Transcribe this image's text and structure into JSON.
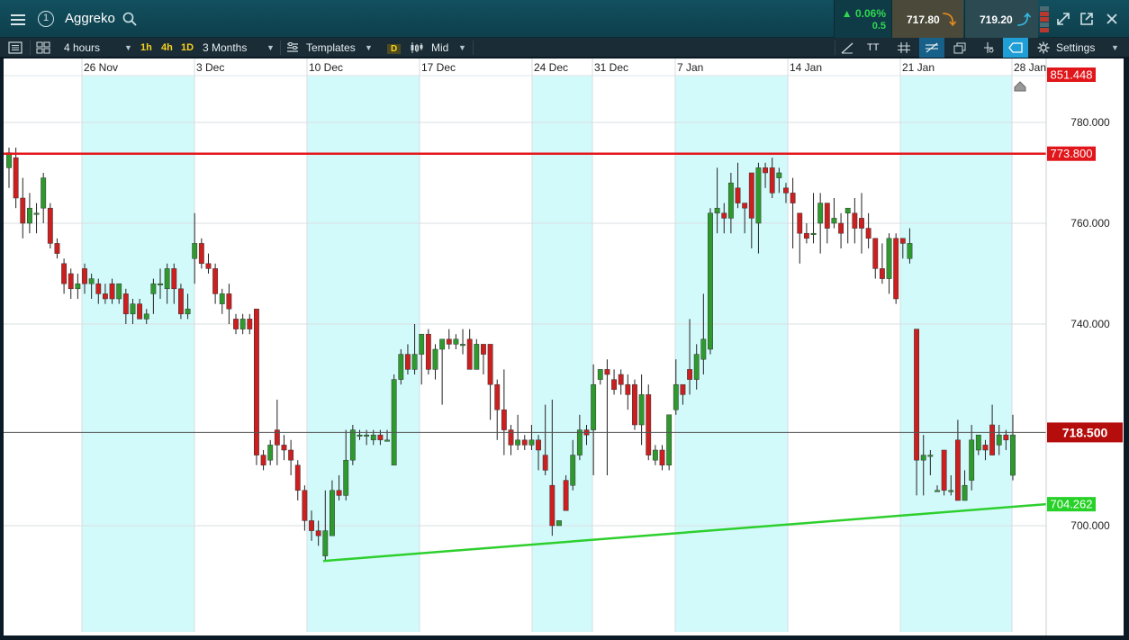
{
  "header": {
    "badge": "1",
    "title": "Aggreko",
    "change_pct": "▲ 0.06%",
    "change_abs": "0.5",
    "bid": "717.80",
    "ask": "719.20"
  },
  "toolbar": {
    "interval": "4 hours",
    "quick_1h": "1h",
    "quick_4h": "4h",
    "quick_1d": "1D",
    "range": "3 Months",
    "templates": "Templates",
    "d_label": "D",
    "price_type": "Mid",
    "text_tool": "TT",
    "settings": "Settings"
  },
  "chart_data": {
    "type": "candlestick",
    "instrument": "Aggreko",
    "timeframe": "4 hours",
    "ylim": [
      686,
      797
    ],
    "yticks": [
      {
        "value": 780,
        "label": "780.000"
      },
      {
        "value": 760,
        "label": "760.000"
      },
      {
        "value": 740,
        "label": "740.000"
      },
      {
        "value": 700,
        "label": "700.000"
      }
    ],
    "xticks": [
      "26 Nov",
      "3 Dec",
      "10 Dec",
      "17 Dec",
      "24 Dec",
      "31 Dec",
      "7 Jan",
      "14 Jan",
      "21 Jan",
      "28 Jan"
    ],
    "price_labels": {
      "top": "851.448",
      "resistance": "773.800",
      "last": "718.500",
      "support": "704.262"
    },
    "resistance_level": 773.8,
    "current_price": 718.5,
    "support_trendline": {
      "start_value": 693,
      "end_value": 704.262
    },
    "colors": {
      "up": "#2e9a2e",
      "down": "#cc1f1f",
      "resistance": "#e3171c",
      "support": "#2dcf2d",
      "highlight": "#d3fafb",
      "last_price": "#b50c0c"
    },
    "candles": [
      [
        771,
        774,
        767,
        775
      ],
      [
        773,
        765,
        763,
        775
      ],
      [
        765,
        760,
        757,
        769
      ],
      [
        760,
        763,
        758,
        766
      ],
      [
        762,
        762,
        758,
        764
      ],
      [
        763,
        769,
        760,
        770
      ],
      [
        763,
        756,
        755,
        764
      ],
      [
        756,
        754,
        753,
        757
      ],
      [
        752,
        748,
        746,
        753
      ],
      [
        750,
        747,
        745,
        751
      ],
      [
        747,
        748,
        745,
        750
      ],
      [
        751,
        748,
        746,
        752
      ],
      [
        748,
        749,
        745,
        750
      ],
      [
        748,
        746,
        744,
        749
      ],
      [
        746,
        745,
        744,
        748
      ],
      [
        748,
        745,
        744,
        749
      ],
      [
        745,
        748,
        744,
        748
      ],
      [
        746,
        742,
        740,
        747
      ],
      [
        742,
        744,
        740,
        745
      ],
      [
        744,
        741,
        741,
        745
      ],
      [
        741,
        742,
        740,
        743
      ],
      [
        746,
        748,
        742,
        749
      ],
      [
        748,
        748,
        745,
        751
      ],
      [
        747,
        751,
        744,
        752
      ],
      [
        751,
        747,
        744,
        752
      ],
      [
        747,
        742,
        741,
        748
      ],
      [
        742,
        743,
        741,
        746
      ],
      [
        753,
        756,
        748,
        762
      ],
      [
        756,
        752,
        751,
        757
      ],
      [
        752,
        751,
        750,
        754
      ],
      [
        751,
        746,
        744,
        752
      ],
      [
        744,
        746,
        742,
        747
      ],
      [
        746,
        743,
        740,
        748
      ],
      [
        741,
        739,
        738,
        742
      ],
      [
        739,
        741,
        738,
        742
      ],
      [
        741,
        739,
        738,
        742
      ],
      [
        743,
        714,
        712,
        743
      ],
      [
        714,
        712,
        711,
        715
      ],
      [
        713,
        716,
        712,
        717
      ],
      [
        719,
        716,
        712,
        725
      ],
      [
        716,
        715,
        713,
        718
      ],
      [
        715,
        713,
        710,
        717
      ],
      [
        712,
        707,
        705,
        713
      ],
      [
        707,
        701,
        699,
        708
      ],
      [
        701,
        699,
        697,
        703
      ],
      [
        699,
        698,
        696,
        701
      ],
      [
        694,
        699,
        693,
        707
      ],
      [
        698,
        707,
        705,
        709
      ],
      [
        707,
        706,
        705,
        710
      ],
      [
        706,
        713,
        705,
        719
      ],
      [
        713,
        719,
        712,
        720
      ],
      [
        718,
        718,
        717,
        719
      ],
      [
        718,
        718,
        716,
        719
      ],
      [
        717,
        718,
        716,
        719
      ],
      [
        718,
        717,
        716,
        719
      ],
      [
        717,
        717,
        717,
        719
      ],
      [
        712,
        729,
        712,
        730
      ],
      [
        729,
        734,
        728,
        735
      ],
      [
        734,
        731,
        730,
        736
      ],
      [
        731,
        734,
        730,
        740
      ],
      [
        734,
        738,
        728,
        737
      ],
      [
        738,
        731,
        730,
        739
      ],
      [
        731,
        735,
        729,
        736
      ],
      [
        735,
        737,
        724,
        737
      ],
      [
        737,
        736,
        735,
        739
      ],
      [
        736,
        737,
        735,
        738
      ],
      [
        736,
        736,
        734,
        739
      ],
      [
        737,
        731,
        732,
        739
      ],
      [
        731,
        736,
        731,
        737
      ],
      [
        736,
        734,
        730,
        736
      ],
      [
        736,
        728,
        721,
        736
      ],
      [
        728,
        723,
        717,
        729
      ],
      [
        723,
        719,
        714,
        731
      ],
      [
        719,
        716,
        714,
        720
      ],
      [
        716,
        717,
        715,
        722
      ],
      [
        717,
        716,
        715,
        718
      ],
      [
        716,
        717,
        715,
        720
      ],
      [
        717,
        715,
        711,
        718
      ],
      [
        714,
        711,
        710,
        724
      ],
      [
        708,
        700,
        698,
        725
      ],
      [
        700,
        701,
        700,
        701
      ],
      [
        709,
        703,
        703,
        710
      ],
      [
        708,
        714,
        707,
        717
      ],
      [
        714,
        719,
        713,
        722
      ],
      [
        719,
        718,
        716,
        720
      ],
      [
        719,
        728,
        710,
        732
      ],
      [
        729,
        731,
        728,
        731
      ],
      [
        731,
        730,
        710,
        733
      ],
      [
        729,
        727,
        726,
        731
      ],
      [
        730,
        728,
        726,
        731
      ],
      [
        728,
        726,
        723,
        730
      ],
      [
        728,
        720,
        719,
        729
      ],
      [
        720,
        726,
        716,
        730
      ],
      [
        726,
        714,
        713,
        728
      ],
      [
        713,
        715,
        712,
        716
      ],
      [
        715,
        712,
        711,
        716
      ],
      [
        712,
        722,
        711,
        722
      ],
      [
        723,
        728,
        722,
        733
      ],
      [
        728,
        726,
        724,
        728
      ],
      [
        731,
        729,
        726,
        741
      ],
      [
        729,
        734,
        727,
        736
      ],
      [
        733,
        737,
        730,
        746
      ],
      [
        735,
        762,
        734,
        763
      ],
      [
        762,
        763,
        758,
        771
      ],
      [
        762,
        761,
        758,
        764
      ],
      [
        761,
        768,
        758,
        770
      ],
      [
        767,
        764,
        763,
        772
      ],
      [
        764,
        763,
        758,
        764
      ],
      [
        770,
        761,
        755,
        770
      ],
      [
        760,
        771,
        754,
        772
      ],
      [
        771,
        770,
        767,
        772
      ],
      [
        771,
        766,
        765,
        773
      ],
      [
        769,
        770,
        766,
        771
      ],
      [
        767,
        766,
        764,
        768
      ],
      [
        766,
        764,
        755,
        769
      ],
      [
        762,
        758,
        752,
        762
      ],
      [
        758,
        757,
        756,
        760
      ],
      [
        758,
        758,
        756,
        766
      ],
      [
        760,
        764,
        754,
        766
      ],
      [
        764,
        759,
        756,
        764
      ],
      [
        760,
        761,
        759,
        765
      ],
      [
        760,
        758,
        755,
        762
      ],
      [
        762,
        763,
        756,
        763
      ],
      [
        762,
        759,
        756,
        765
      ],
      [
        761,
        759,
        754,
        766
      ],
      [
        759,
        757,
        755,
        762
      ],
      [
        757,
        751,
        749,
        757
      ],
      [
        751,
        749,
        748,
        756
      ],
      [
        749,
        757,
        746,
        758
      ],
      [
        757,
        745,
        744,
        758
      ],
      [
        757,
        756,
        753,
        757
      ],
      [
        753,
        756,
        752,
        759
      ],
      [
        739,
        713,
        706,
        738
      ],
      [
        713,
        714,
        706,
        718
      ],
      [
        714,
        714,
        710,
        715
      ],
      [
        707,
        707,
        707,
        708
      ],
      [
        715,
        707,
        706,
        715
      ],
      [
        707,
        707,
        706,
        710
      ],
      [
        717,
        705,
        705,
        721
      ],
      [
        705,
        708,
        706,
        711
      ],
      [
        709,
        717,
        707,
        720
      ],
      [
        715,
        718,
        714,
        718
      ],
      [
        716,
        715,
        713,
        717
      ],
      [
        720,
        714,
        714,
        724
      ],
      [
        716,
        718,
        714,
        720
      ],
      [
        718,
        717,
        715,
        719
      ],
      [
        710,
        718,
        709,
        722
      ]
    ]
  }
}
